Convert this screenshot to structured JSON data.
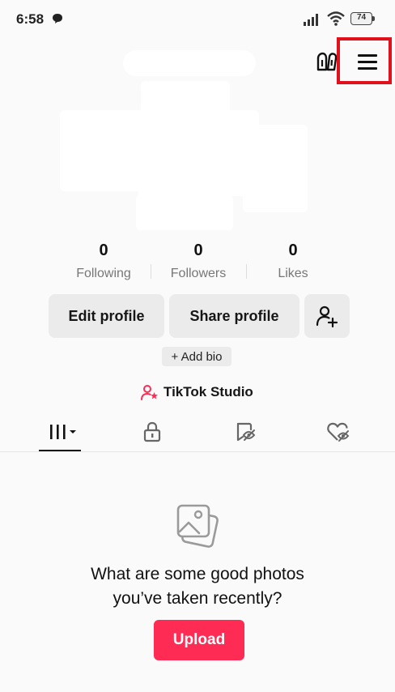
{
  "status_bar": {
    "time": "6:58",
    "battery": "74",
    "icons": [
      "message-icon",
      "signal-icon",
      "wifi-icon",
      "battery-icon"
    ]
  },
  "header": {
    "icons": [
      "friends-icon",
      "menu-icon"
    ],
    "highlight_color": "#e0101c"
  },
  "stats": [
    {
      "value": "0",
      "label": "Following"
    },
    {
      "value": "0",
      "label": "Followers"
    },
    {
      "value": "0",
      "label": "Likes"
    }
  ],
  "actions": {
    "edit_profile": "Edit profile",
    "share_profile": "Share profile",
    "add_friend_icon": "add-user-icon",
    "add_bio": "+ Add bio",
    "studio": "TikTok Studio"
  },
  "tabs": [
    {
      "icon": "videos-grid-icon",
      "selected": true
    },
    {
      "icon": "lock-icon",
      "selected": false
    },
    {
      "icon": "reposts-icon",
      "selected": false
    },
    {
      "icon": "liked-icon",
      "selected": false
    }
  ],
  "empty_state": {
    "icon": "photos-icon",
    "line1": "What are some good photos",
    "line2": "you’ve taken recently?",
    "button": "Upload"
  },
  "colors": {
    "accent": "#fe2c55",
    "background": "#fafafa",
    "button_gray": "#ebebeb"
  }
}
